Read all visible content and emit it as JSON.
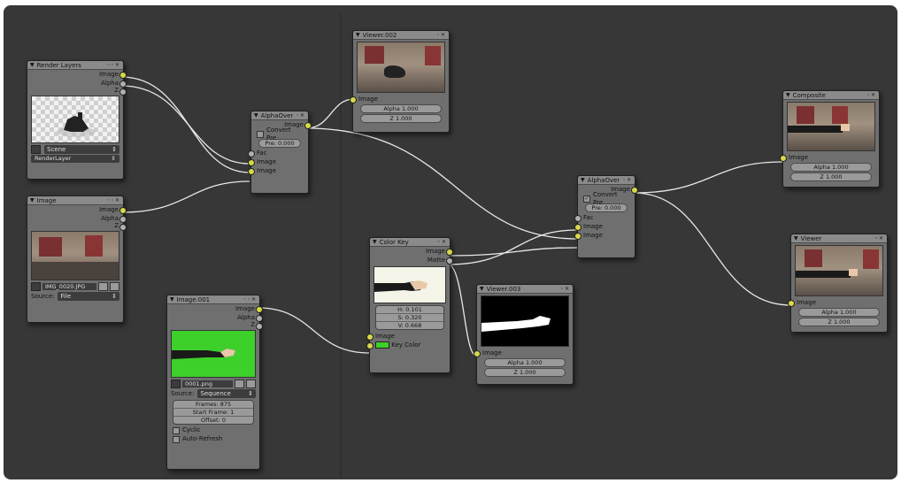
{
  "nodes": {
    "render_layers": {
      "title": "Render Layers",
      "outputs": [
        "Image",
        "Alpha",
        "Z"
      ],
      "scene": "Scene",
      "layer": "RenderLayer"
    },
    "image": {
      "title": "Image",
      "outputs": [
        "Image",
        "Alpha",
        "Z"
      ],
      "filename": "IMG_0020.JPG",
      "source_label": "Source:",
      "source_value": "File"
    },
    "image_001": {
      "title": "Image.001",
      "outputs": [
        "Image",
        "Alpha",
        "Z"
      ],
      "filename": "0001.png",
      "source_label": "Source:",
      "source_value": "Sequence",
      "frames": "Frames: 875",
      "start_frame": "Start Frame: 1",
      "offset": "Offset: 0",
      "cyclic": "Cyclic",
      "auto_refresh": "Auto-Refresh"
    },
    "alpha_over_1": {
      "title": "AlphaOver",
      "output": "Image",
      "convert_pre": "Convert Pre",
      "premul": "Pre: 0.000",
      "inputs": [
        "Fac",
        "Image",
        "Image"
      ]
    },
    "viewer_002": {
      "title": "Viewer.002",
      "input": "Image",
      "alpha": "Alpha 1.000",
      "z": "Z 1.000"
    },
    "color_key": {
      "title": "Color Key",
      "outputs": [
        "Image",
        "Matte"
      ],
      "h": "H: 0.101",
      "s": "S: 0.320",
      "v": "V: 0.668",
      "input": "Image",
      "key_color": "Key Color"
    },
    "viewer_003": {
      "title": "Viewer.003",
      "input": "Image",
      "alpha": "Alpha 1.000",
      "z": "Z 1.000"
    },
    "alpha_over_2": {
      "title": "AlphaOver",
      "output": "Image",
      "convert_pre": "Convert Pre",
      "premul": "Pre: 0.000",
      "inputs": [
        "Fac",
        "Image",
        "Image"
      ]
    },
    "composite": {
      "title": "Composite",
      "input": "Image",
      "alpha": "Alpha 1.000",
      "z": "Z 1.000"
    },
    "viewer": {
      "title": "Viewer",
      "input": "Image",
      "alpha": "Alpha 1.000",
      "z": "Z 1.000"
    }
  },
  "colors": {
    "background": "#373737",
    "node_body": "#6f6f6f",
    "node_header": "#8a8a8a",
    "image_socket": "#d8d84a",
    "value_socket": "#b0b0b0",
    "link": "#e8e8e8",
    "green_screen": "#3ed02a"
  }
}
